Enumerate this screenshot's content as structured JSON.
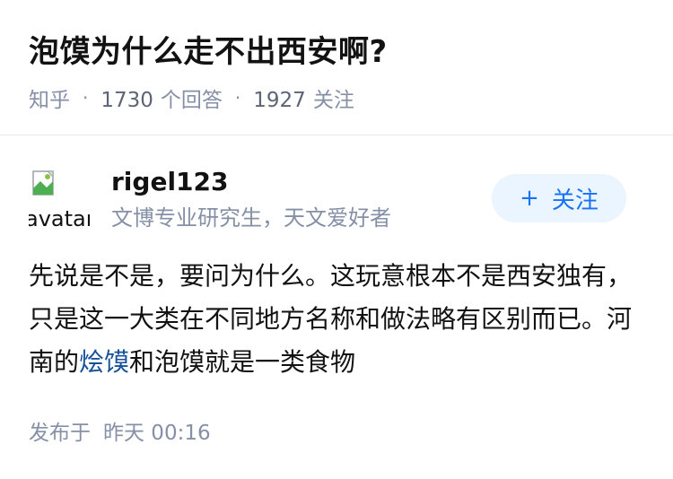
{
  "question": {
    "title": "泡馍为什么走不出西安啊?",
    "source": "知乎",
    "separator": "·",
    "answer_count": "1730",
    "answer_label": "个回答",
    "follower_count": "1927",
    "follower_label": "关注"
  },
  "author": {
    "avatar_alt": "avatar",
    "name": "rigel123",
    "bio": "文博专业研究生，天文爱好者",
    "follow_plus": "+",
    "follow_label": "关注"
  },
  "answer": {
    "text_before_link": "先说是不是，要问为什么。这玩意根本不是西安独有，只是这一大类在不同地方名称和做法略有区别而已。河南的",
    "link_text": "烩馍",
    "text_after_link": "和泡馍就是一类食物"
  },
  "publish": {
    "label": "发布于",
    "time": "昨天 00:16"
  },
  "colors": {
    "accent": "#1772f6",
    "link": "#175199",
    "meta": "#8590a6",
    "follow_bg": "#ebf5ff"
  },
  "icons": {
    "avatar": "broken-image-icon"
  }
}
